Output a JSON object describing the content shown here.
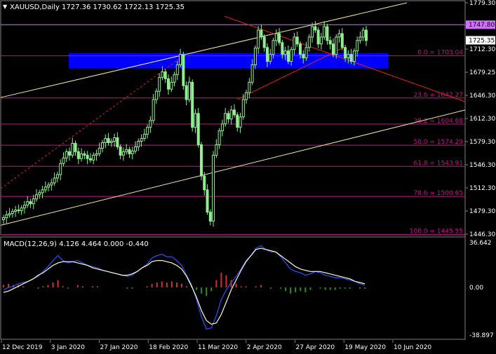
{
  "header": {
    "symbol": "XAUUSD,Daily",
    "ohlc": "1727.36 1730.62 1722.13 1725.35"
  },
  "macd_label": "MACD(12,26,9) 4.126 4.464 0.000 -0.440",
  "colors": {
    "background": "#000000",
    "bull_candle": "#90ee90",
    "fib_line": "#c71585",
    "fib_text": "#c71585",
    "trend_yellow": "#f5e6a0",
    "trend_red": "#e02020",
    "zone_blue": "#0000ff",
    "macd_line": "#3050ff",
    "signal_line": "#ffffcc",
    "hist_up": "#d03030",
    "hist_down": "#2e8b2e",
    "axis_text": "#ffffff",
    "resistance_line": "#d070ff"
  },
  "chart_data": [
    {
      "type": "candlestick",
      "title": "XAUUSD,Daily",
      "ylim": [
        1446.3,
        1779.3
      ],
      "y_ticks": [
        "1779.30",
        "1745.95",
        "1712.30",
        "1679.25",
        "1646.30",
        "1612.30",
        "1579.30",
        "1546.30",
        "1512.30",
        "1479.30",
        "1446.30"
      ],
      "x_ticks": [
        "12 Dec 2019",
        "3 Jan 2020",
        "27 Jan 2020",
        "18 Feb 2020",
        "11 Mar 2020",
        "2 Apr 2020",
        "27 Apr 2020",
        "19 May 2020",
        "10 Jun 2020"
      ],
      "price_marks": [
        {
          "label": "1747.80",
          "kind": "resistance"
        },
        {
          "label": "1725.35",
          "kind": "current"
        }
      ],
      "fibonacci": [
        {
          "level": "0.0",
          "price": 1703.04,
          "label": "0.0 = 1703.04"
        },
        {
          "level": "23.6",
          "price": 1642.27,
          "label": "23.6 = 1642.27"
        },
        {
          "level": "38.2",
          "price": 1604.68,
          "label": "38.2 = 1604.68"
        },
        {
          "level": "50.0",
          "price": 1574.29,
          "label": "50.0 = 1574.29"
        },
        {
          "level": "61.8",
          "price": 1543.91,
          "label": "61.8 = 1543.91"
        },
        {
          "level": "78.6",
          "price": 1500.65,
          "label": "78.6 = 1500.65"
        },
        {
          "level": "100.0",
          "price": 1445.55,
          "label": "100.0 = 1445.55"
        }
      ],
      "zone": {
        "low": 1685,
        "high": 1707
      },
      "closes": [
        1470,
        1474,
        1476,
        1479,
        1481,
        1480,
        1484,
        1488,
        1493,
        1490,
        1497,
        1503,
        1506,
        1510,
        1514,
        1517,
        1520,
        1527,
        1532,
        1548,
        1556,
        1565,
        1560,
        1577,
        1565,
        1555,
        1562,
        1560,
        1555,
        1553,
        1560,
        1562,
        1570,
        1578,
        1584,
        1578,
        1580,
        1585,
        1572,
        1560,
        1565,
        1568,
        1562,
        1566,
        1572,
        1580,
        1584,
        1590,
        1600,
        1610,
        1640,
        1652,
        1672,
        1680,
        1670,
        1655,
        1665,
        1676,
        1690,
        1705,
        1660,
        1640,
        1665,
        1600,
        1620,
        1575,
        1530,
        1510,
        1478,
        1465,
        1560,
        1575,
        1595,
        1605,
        1620,
        1612,
        1625,
        1618,
        1600,
        1615,
        1640,
        1650,
        1665,
        1690,
        1714,
        1740,
        1730,
        1715,
        1695,
        1705,
        1725,
        1735,
        1722,
        1705,
        1710,
        1695,
        1712,
        1730,
        1720,
        1705,
        1700,
        1715,
        1730,
        1745,
        1740,
        1720,
        1730,
        1745,
        1725,
        1720,
        1705,
        1730,
        1735,
        1715,
        1700,
        1705,
        1695,
        1710,
        1725,
        1730,
        1740,
        1725
      ],
      "macd": {
        "label": "MACD(12,26,9) 4.126 4.464 0.000 -0.440",
        "ylim": [
          -38.897,
          36.642
        ],
        "y_ticks": [
          "36.642",
          "0.00",
          "-38.897"
        ],
        "macd_line": [
          -2,
          0,
          1,
          3,
          4,
          5,
          7,
          9,
          13,
          17,
          22,
          26,
          22,
          20,
          21,
          22,
          20,
          18,
          17,
          16,
          14,
          13,
          12,
          11,
          10,
          9,
          10,
          13,
          16,
          19,
          24,
          26,
          27,
          25,
          25,
          22,
          18,
          10,
          2,
          -10,
          -24,
          -34,
          -33,
          -23,
          -10,
          -2,
          4,
          9,
          15,
          22,
          26,
          32,
          34,
          31,
          29,
          29,
          25,
          20,
          15,
          13,
          12,
          10,
          11,
          13,
          12,
          10,
          9,
          8,
          8,
          7,
          6,
          5,
          3,
          2
        ],
        "signal_line": [
          -4,
          -3,
          -1,
          1,
          3,
          5,
          7,
          10,
          12,
          15,
          18,
          20,
          21,
          21,
          21,
          20,
          19,
          18,
          16,
          15,
          14,
          13,
          12,
          11,
          10,
          10,
          11,
          13,
          16,
          18,
          21,
          22,
          22,
          21,
          20,
          18,
          15,
          9,
          1,
          -8,
          -19,
          -27,
          -30,
          -29,
          -22,
          -12,
          -2,
          6,
          14,
          21,
          26,
          31,
          32,
          31,
          30,
          29,
          26,
          23,
          20,
          17,
          15,
          14,
          13,
          13,
          13,
          12,
          11,
          10,
          9,
          8,
          7,
          5,
          4,
          3
        ],
        "histogram": [
          2,
          3,
          2,
          2,
          1,
          0,
          0,
          -1,
          1,
          2,
          4,
          6,
          1,
          -1,
          0,
          2,
          1,
          0,
          1,
          1,
          0,
          0,
          0,
          0,
          0,
          -1,
          -1,
          0,
          0,
          1,
          3,
          4,
          5,
          4,
          5,
          4,
          3,
          1,
          1,
          -2,
          -5,
          -7,
          -3,
          6,
          12,
          10,
          6,
          3,
          1,
          1,
          0,
          1,
          2,
          0,
          -1,
          0,
          -1,
          -3,
          -5,
          -4,
          -3,
          -4,
          -2,
          0,
          -1,
          -2,
          -2,
          -2,
          -1,
          -1,
          -1,
          0,
          -1,
          -1
        ]
      }
    }
  ]
}
